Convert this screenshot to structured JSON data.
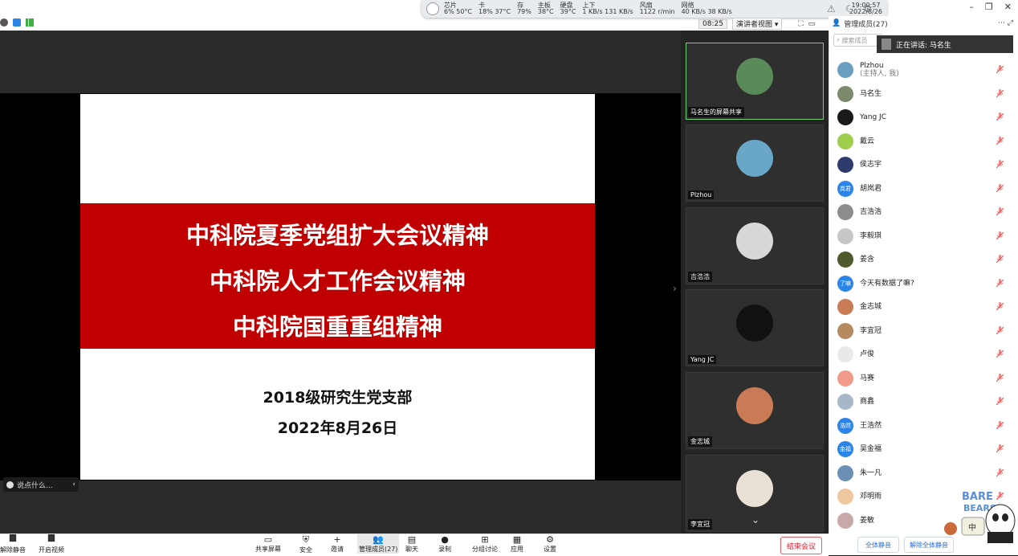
{
  "monitor": {
    "stats": [
      {
        "label": "芯片",
        "value": "6% 50°C"
      },
      {
        "label": "卡",
        "value": "18% 37°C"
      },
      {
        "label": "存",
        "value": "79%"
      },
      {
        "label": "主板",
        "value": "38°C"
      },
      {
        "label": "硬盘",
        "value": "39°C"
      },
      {
        "label": "上下",
        "value": "1 KB/s 131 KB/s"
      },
      {
        "label": "风扇",
        "value": "1122 r/min"
      },
      {
        "label": "网络",
        "value": "40 KB/s 38 KB/s"
      }
    ],
    "time": "19:00:57",
    "date": "2022/8/26"
  },
  "header": {
    "timer": "08:25",
    "view_mode": "演讲者视图",
    "panel_title": "管理成员(27)"
  },
  "slide": {
    "lines": [
      "中科院夏季党组扩大会议精神",
      "中科院人才工作会议精神",
      "中科院国重重组精神"
    ],
    "org": "2018级研究生党支部",
    "date": "2022年8月26日"
  },
  "chat_pill": "说点什么...",
  "gallery": [
    {
      "name": "马名生的屏幕共享",
      "color": "#5b8a5a"
    },
    {
      "name": "Plzhou",
      "color": "#6aa6c8"
    },
    {
      "name": "吉浩浩",
      "color": "#d8d8d8"
    },
    {
      "name": "Yang JC",
      "color": "#111111"
    },
    {
      "name": "金志城",
      "color": "#c97b55"
    },
    {
      "name": "李宜冠",
      "color": "#e8e0d4"
    }
  ],
  "panel": {
    "search_placeholder": "搜索成员",
    "speaking": "正在讲话: 马名生",
    "participants": [
      {
        "name": "Plzhou",
        "sub": "(主持人, 我)",
        "color": "#6b9fbf",
        "txt": ""
      },
      {
        "name": "马名生",
        "sub": "",
        "color": "#7a8a6a",
        "txt": ""
      },
      {
        "name": "Yang JC",
        "sub": "",
        "color": "#1a1a1a",
        "txt": ""
      },
      {
        "name": "戴云",
        "sub": "",
        "color": "#9fce4c",
        "txt": ""
      },
      {
        "name": "侯志宇",
        "sub": "",
        "color": "#2d3b6e",
        "txt": ""
      },
      {
        "name": "胡岚君",
        "sub": "",
        "color": "#2b84e8",
        "txt": "岚君"
      },
      {
        "name": "吉浩浩",
        "sub": "",
        "color": "#8c8c8c",
        "txt": ""
      },
      {
        "name": "李毅琪",
        "sub": "",
        "color": "#c7c7c7",
        "txt": ""
      },
      {
        "name": "姜含",
        "sub": "",
        "color": "#4e5a2d",
        "txt": ""
      },
      {
        "name": "今天有数据了嘛?",
        "sub": "",
        "color": "#2b84e8",
        "txt": "了嘛"
      },
      {
        "name": "金志城",
        "sub": "",
        "color": "#c97b55",
        "txt": ""
      },
      {
        "name": "李宜冠",
        "sub": "",
        "color": "#b48a5e",
        "txt": ""
      },
      {
        "name": "卢俊",
        "sub": "",
        "color": "#e9e9e9",
        "txt": ""
      },
      {
        "name": "马赛",
        "sub": "",
        "color": "#f29a8a",
        "txt": ""
      },
      {
        "name": "商鑫",
        "sub": "",
        "color": "#a7b7c7",
        "txt": ""
      },
      {
        "name": "王浩然",
        "sub": "",
        "color": "#2b84e8",
        "txt": "浩然"
      },
      {
        "name": "吴金福",
        "sub": "",
        "color": "#2b84e8",
        "txt": "金福"
      },
      {
        "name": "朱一凡",
        "sub": "",
        "color": "#6c8fb5",
        "txt": ""
      },
      {
        "name": "邓明雨",
        "sub": "",
        "color": "#f0c8a0",
        "txt": ""
      },
      {
        "name": "姜敏",
        "sub": "",
        "color": "#c8a8a8",
        "txt": ""
      }
    ],
    "mute_all": "全体静音",
    "unmute_all": "解除全体静音"
  },
  "toolbar": {
    "left": [
      {
        "label": "解除静音",
        "icon": "mic-muted-icon"
      },
      {
        "label": "开启视频",
        "icon": "video-off-icon"
      }
    ],
    "center": [
      {
        "label": "共享屏幕",
        "icon": "share-screen-icon"
      },
      {
        "label": "安全",
        "icon": "shield-icon"
      },
      {
        "label": "邀请",
        "icon": "invite-icon"
      },
      {
        "label": "管理成员(27)",
        "icon": "participants-icon"
      },
      {
        "label": "聊天",
        "icon": "chat-icon"
      },
      {
        "label": "录制",
        "icon": "record-icon"
      },
      {
        "label": "分组讨论",
        "icon": "breakout-icon"
      },
      {
        "label": "应用",
        "icon": "apps-icon"
      },
      {
        "label": "设置",
        "icon": "gear-icon"
      }
    ],
    "end": "结束会议"
  }
}
